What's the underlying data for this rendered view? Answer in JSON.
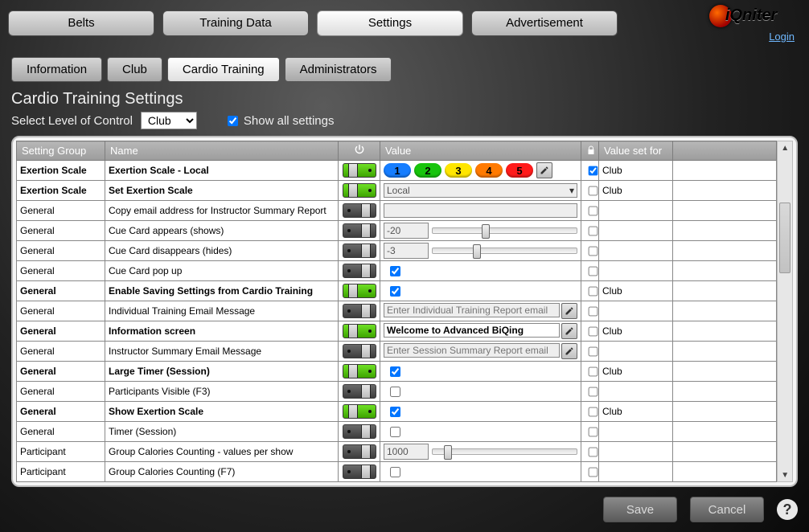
{
  "topTabs": {
    "belts": "Belts",
    "training": "Training Data",
    "settings": "Settings",
    "ads": "Advertisement"
  },
  "logo": {
    "text": "iQniter"
  },
  "loginLabel": "Login",
  "subTabs": {
    "information": "Information",
    "club": "Club",
    "cardio": "Cardio Training",
    "administrators": "Administrators"
  },
  "pageTitle": "Cardio Training Settings",
  "levelLabel": "Select Level of Control",
  "levelValue": "Club",
  "showAllLabel": "Show all settings",
  "showAllChecked": true,
  "headers": {
    "group": "Setting Group",
    "name": "Name",
    "value": "Value",
    "setfor": "Value set for"
  },
  "zones": [
    {
      "n": "1",
      "color": "#157dff"
    },
    {
      "n": "2",
      "color": "#17c40c"
    },
    {
      "n": "3",
      "color": "#ffe600"
    },
    {
      "n": "4",
      "color": "#ff7a00"
    },
    {
      "n": "5",
      "color": "#ff1a1a"
    }
  ],
  "rows": [
    {
      "bold": true,
      "group": "Exertion Scale",
      "name": "Exertion Scale - Local",
      "toggle": "on",
      "value": {
        "type": "zones"
      },
      "lockChecked": true,
      "setfor": "Club"
    },
    {
      "bold": true,
      "group": "Exertion Scale",
      "name": "Set Exertion Scale",
      "toggle": "on",
      "value": {
        "type": "select",
        "text": "Local"
      },
      "lockChecked": false,
      "setfor": "Club"
    },
    {
      "bold": false,
      "group": "General",
      "name": "Copy email address for Instructor Summary Report",
      "toggle": "off",
      "value": {
        "type": "text",
        "text": ""
      },
      "lockChecked": false,
      "setfor": ""
    },
    {
      "bold": false,
      "group": "General",
      "name": "Cue Card appears (shows)",
      "toggle": "off",
      "value": {
        "type": "slider",
        "text": "-20",
        "pos": 34
      },
      "lockChecked": false,
      "setfor": ""
    },
    {
      "bold": false,
      "group": "General",
      "name": "Cue Card disappears (hides)",
      "toggle": "off",
      "value": {
        "type": "slider",
        "text": "-3",
        "pos": 28
      },
      "lockChecked": false,
      "setfor": ""
    },
    {
      "bold": false,
      "group": "General",
      "name": "Cue Card pop up",
      "toggle": "off",
      "value": {
        "type": "check",
        "checked": true
      },
      "lockChecked": false,
      "setfor": ""
    },
    {
      "bold": true,
      "group": "General",
      "name": "Enable Saving Settings from Cardio Training",
      "toggle": "on",
      "value": {
        "type": "check",
        "checked": true
      },
      "lockChecked": false,
      "setfor": "Club"
    },
    {
      "bold": false,
      "group": "General",
      "name": "Individual Training Email Message",
      "toggle": "off",
      "value": {
        "type": "textedit",
        "placeholder": "Enter Individual Training Report email"
      },
      "lockChecked": false,
      "setfor": ""
    },
    {
      "bold": true,
      "group": "General",
      "name": "Information screen",
      "toggle": "on",
      "value": {
        "type": "textedit",
        "text": "Welcome to Advanced BiQing",
        "bold": true
      },
      "lockChecked": false,
      "setfor": "Club"
    },
    {
      "bold": false,
      "group": "General",
      "name": "Instructor Summary Email Message",
      "toggle": "off",
      "value": {
        "type": "textedit",
        "placeholder": "Enter Session Summary Report email"
      },
      "lockChecked": false,
      "setfor": ""
    },
    {
      "bold": true,
      "group": "General",
      "name": "Large Timer (Session)",
      "toggle": "on",
      "value": {
        "type": "check",
        "checked": true
      },
      "lockChecked": false,
      "setfor": "Club"
    },
    {
      "bold": false,
      "group": "General",
      "name": "Participants Visible (F3)",
      "toggle": "off",
      "value": {
        "type": "check",
        "checked": false
      },
      "lockChecked": false,
      "setfor": ""
    },
    {
      "bold": true,
      "group": "General",
      "name": "Show Exertion Scale",
      "toggle": "on",
      "value": {
        "type": "check",
        "checked": true
      },
      "lockChecked": false,
      "setfor": "Club"
    },
    {
      "bold": false,
      "group": "General",
      "name": "Timer (Session)",
      "toggle": "off",
      "value": {
        "type": "check",
        "checked": false
      },
      "lockChecked": false,
      "setfor": ""
    },
    {
      "bold": false,
      "group": "Participant",
      "name": "Group Calories Counting - values per show",
      "toggle": "off",
      "value": {
        "type": "slider",
        "text": "1000",
        "pos": 8
      },
      "lockChecked": false,
      "setfor": ""
    },
    {
      "bold": false,
      "group": "Participant",
      "name": "Group Calories Counting (F7)",
      "toggle": "off",
      "value": {
        "type": "check",
        "checked": false
      },
      "lockChecked": false,
      "setfor": ""
    }
  ],
  "buttons": {
    "save": "Save",
    "cancel": "Cancel",
    "help": "?"
  }
}
